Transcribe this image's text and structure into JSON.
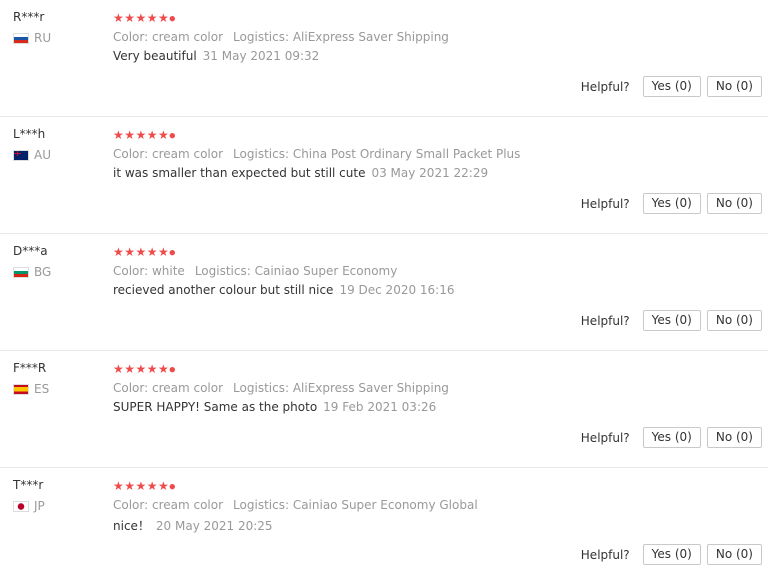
{
  "reviews": [
    {
      "user": "R***r",
      "country": "RU",
      "flag": [
        "#ffffff",
        "#1c57a7",
        "#d52b1e"
      ],
      "stars": "★★★★★",
      "color": "Color: cream color",
      "logistics": "Logistics: AliExpress Saver Shipping",
      "text": "Very beautiful",
      "date": "31 May 2021 09:32",
      "helpful": "Helpful?",
      "yes": "Yes (0)",
      "no": "No (0)"
    },
    {
      "user": "L***h",
      "country": "AU",
      "flag": [
        "#012169",
        "#012169",
        "#012169"
      ],
      "stars": "★★★★★",
      "color": "Color: cream color",
      "logistics": "Logistics: China Post Ordinary Small Packet Plus",
      "text": "it was smaller than expected but still cute",
      "date": "03 May 2021 22:29",
      "helpful": "Helpful?",
      "yes": "Yes (0)",
      "no": "No (0)"
    },
    {
      "user": "D***a",
      "country": "BG",
      "flag": [
        "#ffffff",
        "#00966e",
        "#d62612"
      ],
      "stars": "★★★★★",
      "color": "Color: white",
      "logistics": "Logistics: Cainiao Super Economy",
      "text": "recieved another colour but still nice",
      "date": "19 Dec 2020 16:16",
      "helpful": "Helpful?",
      "yes": "Yes (0)",
      "no": "No (0)"
    },
    {
      "user": "F***R",
      "country": "ES",
      "flag": [
        "#c60b1e",
        "#ffc400",
        "#c60b1e"
      ],
      "stars": "★★★★★",
      "color": "Color: cream color",
      "logistics": "Logistics: AliExpress Saver Shipping",
      "text": "SUPER HAPPY! Same as the photo",
      "date": "19 Feb 2021 03:26",
      "helpful": "Helpful?",
      "yes": "Yes (0)",
      "no": "No (0)"
    },
    {
      "user": "T***r",
      "country": "JP",
      "flag": [
        "#ffffff",
        "#bc002d",
        "#ffffff"
      ],
      "stars": "★★★★★",
      "color": "Color: cream color",
      "logistics": "Logistics: Cainiao Super Economy Global",
      "text": "nice！",
      "date": "20 May 2021 20:25",
      "helpful": "Helpful?",
      "yes": "Yes (0)",
      "no": "No (0)"
    }
  ]
}
